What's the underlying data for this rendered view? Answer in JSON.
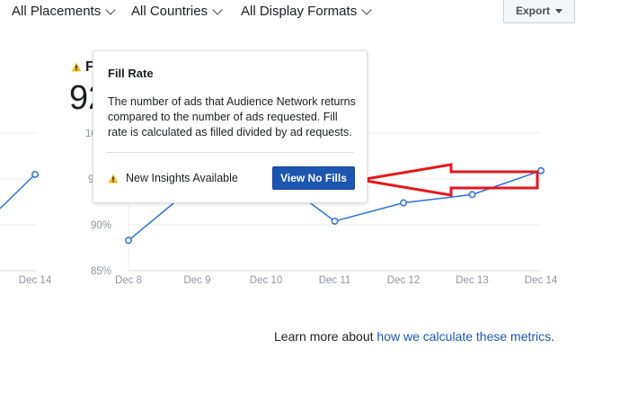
{
  "filters": {
    "placements": "All Placements",
    "countries": "All Countries",
    "formats": "All Display Formats"
  },
  "export_label": "Export",
  "metric": {
    "title_partial": "F",
    "value_partial": "92"
  },
  "chart_data": {
    "type": "line",
    "panels": [
      {
        "name": "left-partial",
        "x": [
          "Dec 14"
        ],
        "y": [
          95.5
        ]
      },
      {
        "name": "fill-rate",
        "x": [
          "Dec 8",
          "Dec 9",
          "Dec 10",
          "Dec 11",
          "Dec 12",
          "Dec 13",
          "Dec 14"
        ],
        "y": [
          88.3,
          94.5,
          96.0,
          90.4,
          92.4,
          93.3,
          95.9
        ],
        "y_ticks": [
          "85%",
          "90%",
          "9",
          "10"
        ],
        "ylim": [
          85,
          100
        ]
      }
    ],
    "line_color": "#2d6fd6",
    "grid": true
  },
  "tooltip": {
    "title": "Fill Rate",
    "body": "The number of ads that Audience Network returns compared to the number of ads requested. Fill rate is calculated as filled divided by ad requests.",
    "insights_label": "New Insights Available",
    "button_label": "View No Fills"
  },
  "footer": {
    "prefix": "Learn more about ",
    "link": "how we calculate these metrics",
    "suffix": "."
  },
  "colors": {
    "warning": "#f7b928",
    "arrow": "#e3181f",
    "button": "#1d56b1"
  }
}
